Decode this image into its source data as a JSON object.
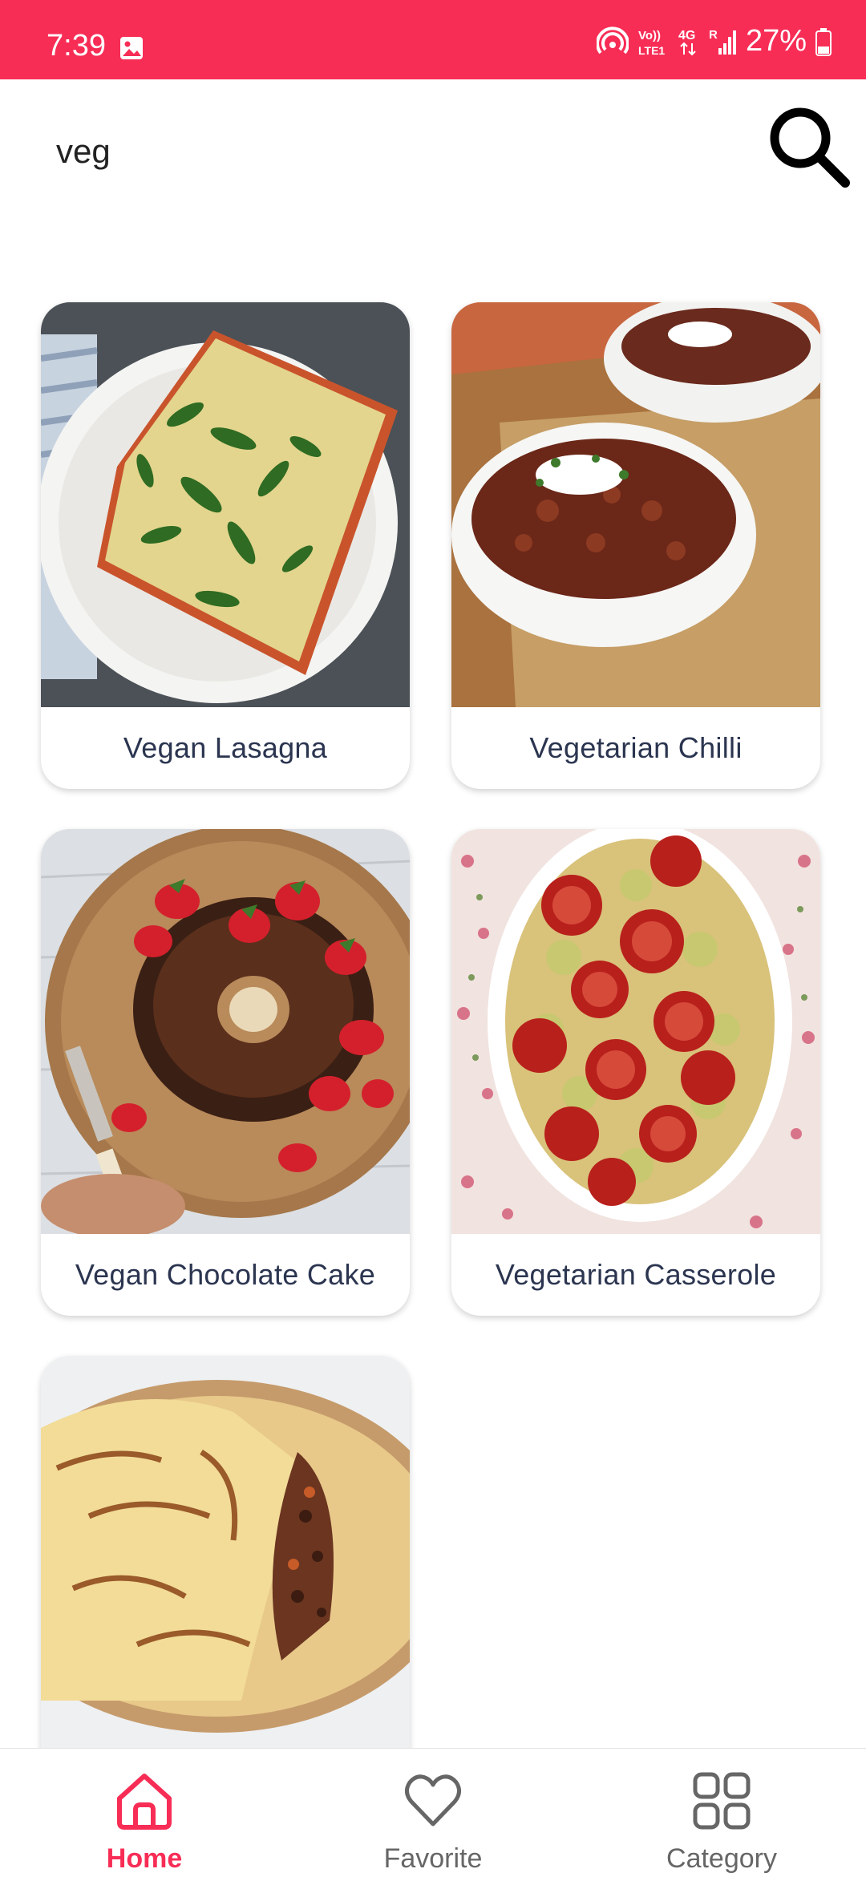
{
  "status_bar": {
    "time": "7:39",
    "battery": "27%",
    "icons": [
      "gallery-icon",
      "hotspot-icon",
      "volte-icon",
      "4g-icon",
      "signal-icon",
      "battery-icon"
    ]
  },
  "search": {
    "value": "veg",
    "icon": "search-icon"
  },
  "recipes": [
    {
      "title": "Vegan Lasagna"
    },
    {
      "title": "Vegetarian Chilli"
    },
    {
      "title": "Vegan Chocolate Cake"
    },
    {
      "title": "Vegetarian Casserole"
    },
    {
      "title": ""
    }
  ],
  "bottom_nav": {
    "items": [
      {
        "label": "Home",
        "icon": "home-icon",
        "active": true
      },
      {
        "label": "Favorite",
        "icon": "heart-icon",
        "active": false
      },
      {
        "label": "Category",
        "icon": "category-grid-icon",
        "active": false
      }
    ]
  },
  "colors": {
    "accent": "#f72d56",
    "card_title": "#2b3550",
    "nav_inactive": "#666666"
  }
}
